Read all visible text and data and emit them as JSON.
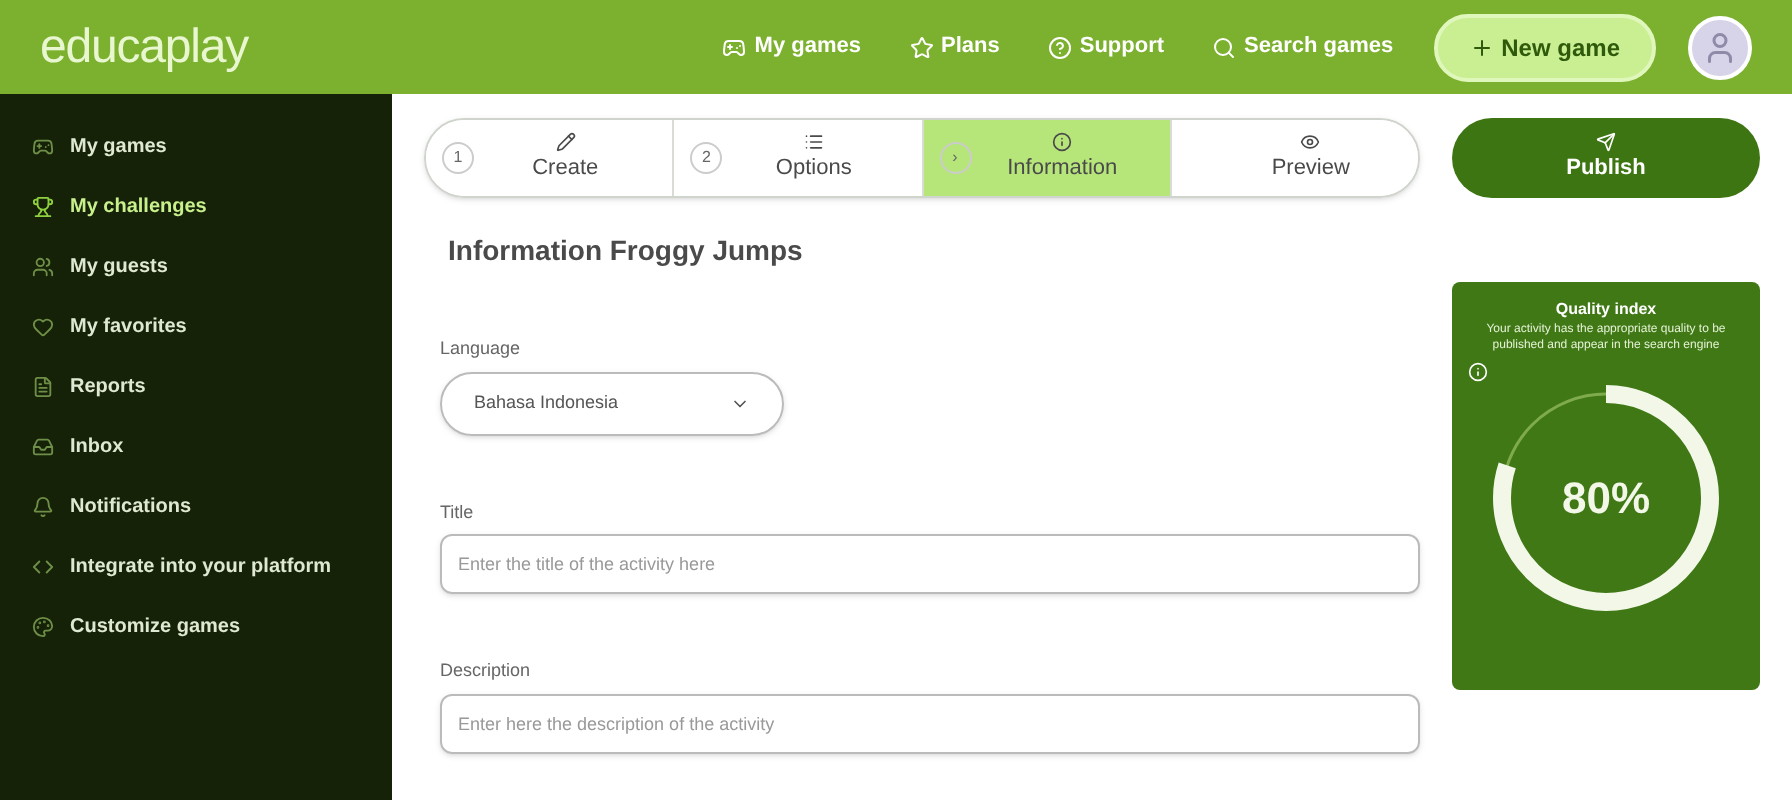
{
  "header": {
    "logo": "educaplay",
    "nav": [
      {
        "label": "My games"
      },
      {
        "label": "Plans"
      },
      {
        "label": "Support"
      },
      {
        "label": "Search games"
      }
    ],
    "new_game": "New game"
  },
  "sidebar": {
    "items": [
      {
        "label": "My games",
        "selected": false
      },
      {
        "label": "My challenges",
        "selected": true
      },
      {
        "label": "My guests",
        "selected": false
      },
      {
        "label": "My favorites",
        "selected": false
      },
      {
        "label": "Reports",
        "selected": false
      },
      {
        "label": "Inbox",
        "selected": false
      },
      {
        "label": "Notifications",
        "selected": false
      },
      {
        "label": "Integrate into your platform",
        "selected": false
      },
      {
        "label": "Customize games",
        "selected": false
      }
    ]
  },
  "steps": [
    {
      "marker": "1",
      "label": "Create",
      "selected": false
    },
    {
      "marker": "2",
      "label": "Options",
      "selected": false
    },
    {
      "marker": "›",
      "label": "Information",
      "selected": true
    },
    {
      "label": "Preview",
      "selected": false
    }
  ],
  "publish": "Publish",
  "heading": "Information Froggy Jumps",
  "language": {
    "label": "Language",
    "value": "Bahasa Indonesia"
  },
  "title_field": {
    "label": "Title",
    "placeholder": "Enter the title of the activity here"
  },
  "description_field": {
    "label": "Description",
    "placeholder": "Enter here the description of the activity"
  },
  "quality": {
    "title": "Quality index",
    "text": "Your activity has the appropriate quality to be published and appear in the search engine",
    "reading": "80%",
    "level": 0.8
  }
}
